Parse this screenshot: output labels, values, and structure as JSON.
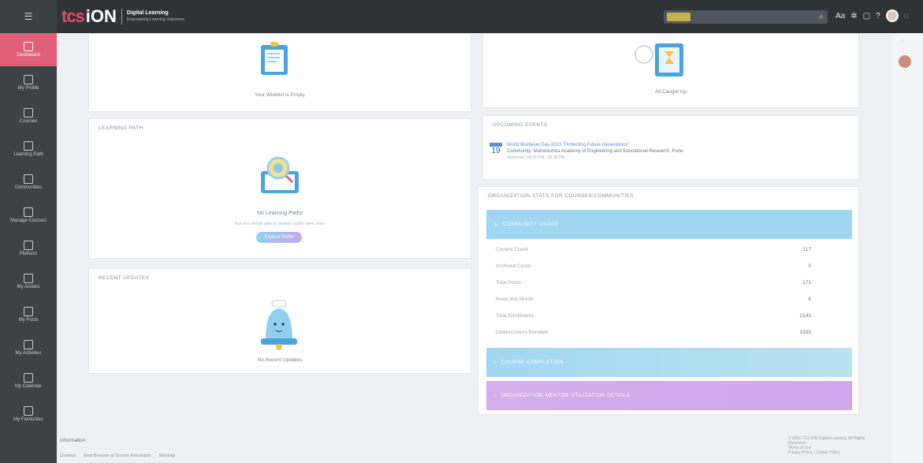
{
  "topbar": {
    "logo_tcs": "tcs",
    "logo_ion": "iON",
    "logo_line1": "Digital Learning",
    "logo_line2": "Empowering Learning Outcomes",
    "search_placeholder": ""
  },
  "sidebar": {
    "items": [
      {
        "label": "Dashboard",
        "active": true
      },
      {
        "label": "My Profile"
      },
      {
        "label": "Courses"
      },
      {
        "label": "Learning Path"
      },
      {
        "label": "Communities"
      },
      {
        "label": "Manage Courses"
      },
      {
        "label": "Platform"
      },
      {
        "label": "My Actions"
      },
      {
        "label": "My Posts"
      },
      {
        "label": "My Activities"
      },
      {
        "label": "My Calendar"
      },
      {
        "label": "My Favourites"
      }
    ]
  },
  "wishlist": {
    "caption": "Your Wishlist is Empty"
  },
  "caughtup": {
    "caption": "All Caught Up"
  },
  "learning_path": {
    "title": "LEARNING PATH",
    "empty": "No Learning Paths",
    "hint": "But you will be able to explore paths here soon",
    "button": "Explore Paths"
  },
  "recent_updates": {
    "title": "RECENT UPDATES",
    "empty": "No Recent Updates"
  },
  "upcoming_events": {
    "title": "UPCOMING EVENTS",
    "day": "19",
    "event_title": "World Biodiesel Day-2023 \"Protecting Future Generations\"",
    "event_org": "Community: Maharashtra Academy of Engineering and Educational Research, Pune",
    "event_time": "Tomorrow | 05:30 PM - 06:30 PM"
  },
  "org_stats": {
    "title": "ORGANIZATION STATS FOR COURSES/COMMUNITIES",
    "community_usage": "COMMUNITY USAGE",
    "rows": [
      {
        "label": "Current Count",
        "value": "217"
      },
      {
        "label": "Archived Count",
        "value": "0"
      },
      {
        "label": "Total Posts",
        "value": "171"
      },
      {
        "label": "Posts this Month",
        "value": "6"
      },
      {
        "label": "Total Enrolments",
        "value": "2143"
      },
      {
        "label": "Distinct Users Enrolled",
        "value": "1935"
      }
    ],
    "course_completion": "COURSE COMPLETION",
    "org_mentor": "ORGANIZATION MENTOR UTILIZATION DETAILS"
  },
  "footer": {
    "info": "Information",
    "link1": "Desktop",
    "link2": "Best Browser at Screen Resolution",
    "link3": "Sitemap",
    "right_line1": "© 2023 TCS iON Digital Learning. All Rights Reserved.",
    "right_line2": "Terms of Use",
    "right_line3": "Privacy Policy | Cookie Policy"
  }
}
